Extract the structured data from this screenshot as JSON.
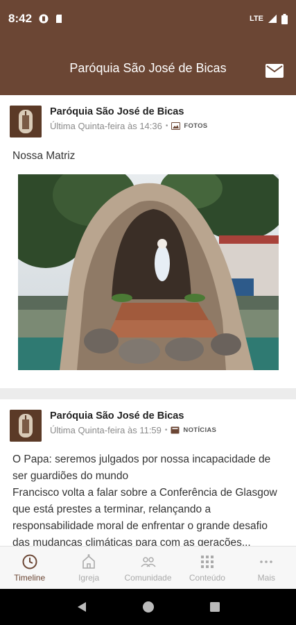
{
  "status_bar": {
    "time": "8:42",
    "network": "LTE"
  },
  "app_bar": {
    "title": "Paróquia São José de Bicas"
  },
  "posts": [
    {
      "author": "Paróquia São José de Bicas",
      "time": "Última Quinta-feira às 14:36",
      "category": "FOTOS",
      "text": "Nossa Matriz"
    },
    {
      "author": "Paróquia São José de Bicas",
      "time": "Última Quinta-feira às 11:59",
      "category": "NOTÍCIAS",
      "headline": "O Papa: seremos julgados por nossa incapacidade de ser guardiões do mundo",
      "body": "Francisco volta a falar sobre a Conferência de Glasgow que está prestes a terminar, relançando a responsabilidade moral de enfrentar o grande desafio das mudanças climáticas para com as gerações..."
    }
  ],
  "bottom_nav": [
    {
      "label": "Timeline",
      "icon": "clock-icon",
      "active": true
    },
    {
      "label": "Igreja",
      "icon": "church-icon",
      "active": false
    },
    {
      "label": "Comunidade",
      "icon": "people-icon",
      "active": false
    },
    {
      "label": "Conteúdo",
      "icon": "grid-icon",
      "active": false
    },
    {
      "label": "Mais",
      "icon": "more-icon",
      "active": false
    }
  ],
  "colors": {
    "primary": "#6b4634",
    "inactive": "#aaaaaa"
  }
}
